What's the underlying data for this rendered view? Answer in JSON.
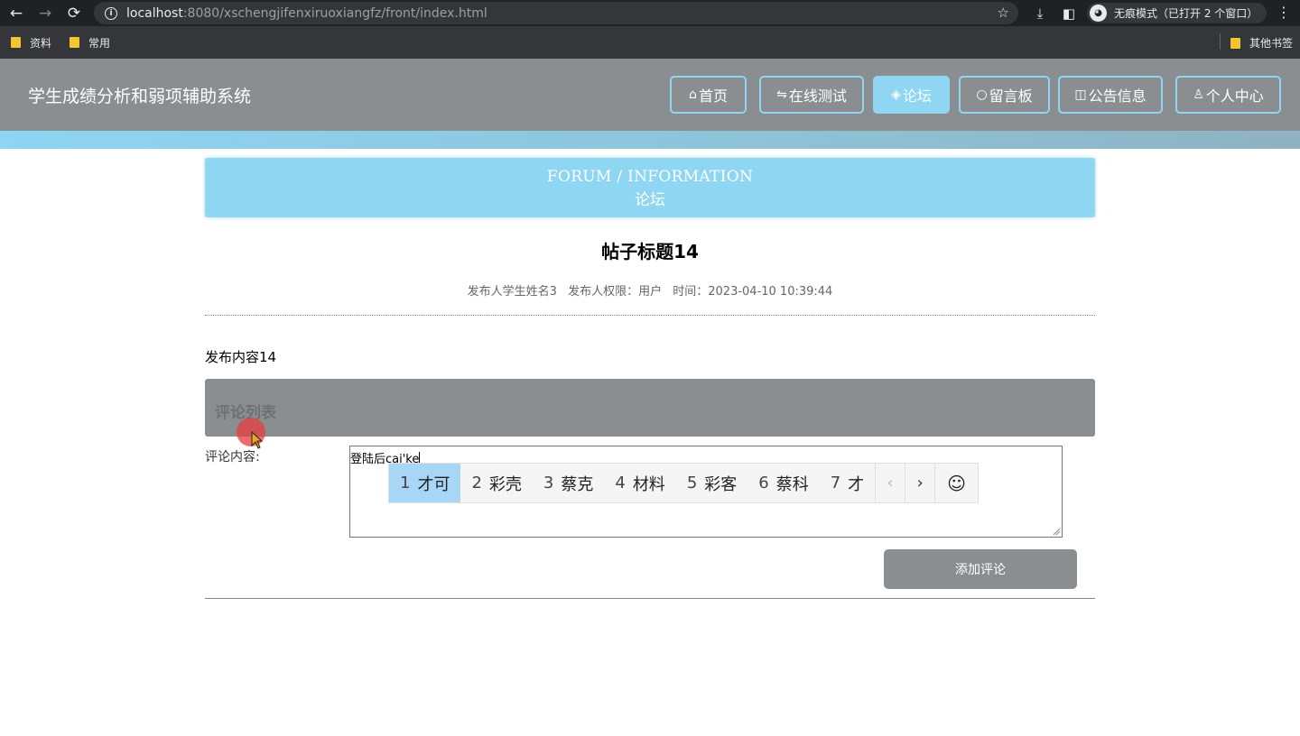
{
  "browser": {
    "url_host": "localhost",
    "url_path": ":8080/xschengjifenxiruoxiangfz/front/index.html",
    "incognito_label": "无痕模式（已打开 2 个窗口）",
    "bookmarks": [
      "资料",
      "常用"
    ],
    "other_bookmarks": "其他书签"
  },
  "site": {
    "title": "学生成绩分析和弱项辅助系统",
    "nav": [
      {
        "label": "首页",
        "icon": "home-icon"
      },
      {
        "label": "在线测试",
        "icon": "sliders-icon"
      },
      {
        "label": "论坛",
        "icon": "layers-icon"
      },
      {
        "label": "留言板",
        "icon": "chat-icon"
      },
      {
        "label": "公告信息",
        "icon": "notice-icon"
      },
      {
        "label": "个人中心",
        "icon": "user-icon"
      }
    ],
    "active_nav": "论坛"
  },
  "banner": {
    "en": "FORUM / INFORMATION",
    "cn": "论坛"
  },
  "post": {
    "title": "帖子标题14",
    "author": "发布人学生姓名3",
    "role": "发布人权限：用户",
    "time": "时间：2023-04-10 10:39:44",
    "content": "发布内容14"
  },
  "comments": {
    "header": "评论列表",
    "label": "评论内容:",
    "value": "登陆后cai'ke",
    "submit_label": "添加评论"
  },
  "ime": {
    "candidates": [
      {
        "num": "1",
        "text": "才可"
      },
      {
        "num": "2",
        "text": "彩壳"
      },
      {
        "num": "3",
        "text": "蔡克"
      },
      {
        "num": "4",
        "text": "材料"
      },
      {
        "num": "5",
        "text": "彩客"
      },
      {
        "num": "6",
        "text": "蔡科"
      },
      {
        "num": "7",
        "text": "才"
      }
    ],
    "selected_index": 0,
    "emoji": "☺"
  },
  "colors": {
    "accent": "#8fd6f3",
    "header_bg": "#8a8e91"
  }
}
